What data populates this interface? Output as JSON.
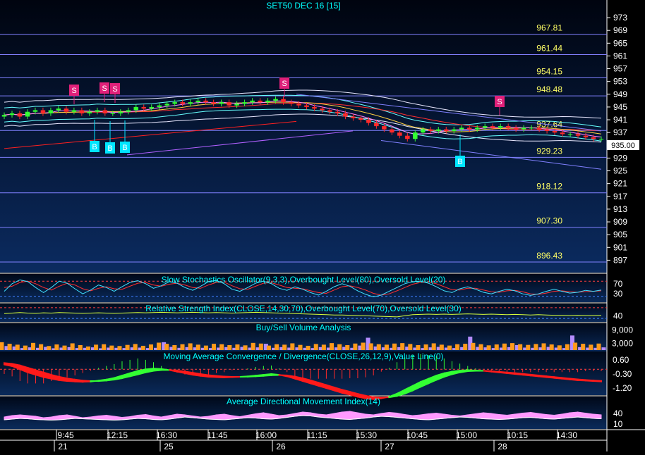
{
  "title": "SET50 DEC 16   [15]",
  "colors": {
    "background_top": "#00061a",
    "background_bottom": "#0a2a5e",
    "fib_line": "#8080ff",
    "fib_label": "#ffff66",
    "axis_text": "#ffffff",
    "last_price_box": "#ffffff",
    "indicator_title": "#00ffff",
    "sell_marker": "#e0207a",
    "buy_marker": "#00e5ff",
    "bar_volume": "#ff9a1a",
    "bar_volume_alt": "#b48cff",
    "macd_fill_neg": "#ff1a1a",
    "macd_fill_pos": "#33ff33",
    "adx_fill": "#ff99ff"
  },
  "chart_data": [
    {
      "type": "line",
      "panel": "price",
      "title": "SET50 DEC 16   [15]",
      "ylim": [
        894,
        975
      ],
      "y_ticks": [
        "973",
        "969",
        "965",
        "961",
        "957",
        "953",
        "949",
        "945",
        "941",
        "937",
        "933",
        "929",
        "925",
        "921",
        "917",
        "913",
        "909",
        "905",
        "901",
        "897"
      ],
      "last_price": "935.00",
      "fib_levels": [
        {
          "label": "967.81",
          "value": 967.81
        },
        {
          "label": "961.44",
          "value": 961.44
        },
        {
          "label": "954.15",
          "value": 954.15
        },
        {
          "label": "948.48",
          "value": 948.48
        },
        {
          "label": "937.64",
          "value": 937.64
        },
        {
          "label": "929.23",
          "value": 929.23
        },
        {
          "label": "918.12",
          "value": 918.12
        },
        {
          "label": "907.30",
          "value": 907.3
        },
        {
          "label": "896.43",
          "value": 896.43
        }
      ],
      "x_time_labels": [
        "9:45",
        "12:15",
        "16:30",
        "11:45",
        "16:00",
        "11:15",
        "15:30",
        "10:45",
        "15:00",
        "10:15",
        "14:30"
      ],
      "x_date_labels": [
        "21",
        "25",
        "26",
        "27",
        "28"
      ],
      "close": [
        942.5,
        943,
        942,
        943.5,
        944,
        943,
        944,
        944.5,
        943.5,
        944,
        943,
        943.5,
        944,
        943,
        943,
        943.5,
        944,
        945,
        944.5,
        945,
        945.5,
        946,
        946.5,
        946,
        946.5,
        947,
        946.5,
        946,
        946.5,
        945.5,
        946,
        946.5,
        947,
        946.5,
        947,
        947.5,
        946.5,
        946,
        945.5,
        945,
        944.5,
        944,
        943.5,
        943,
        942,
        941.5,
        941,
        940,
        939,
        938,
        937,
        936,
        935,
        937,
        938,
        937.5,
        938,
        937.5,
        938,
        938.5,
        938,
        938.5,
        939,
        938.5,
        939,
        938.5,
        938,
        938.5,
        938.5,
        938,
        937.5,
        937,
        936.5,
        936.5,
        936,
        935.5,
        935,
        935
      ]
    },
    {
      "type": "line",
      "panel": "stochastic",
      "title": "Slow Stochastics Oscillator(9,3,3),Overbought Level(80),Oversold Level(20)",
      "y_ticks": [
        "70",
        "30"
      ],
      "ylim": [
        0,
        100
      ],
      "k": [
        40,
        70,
        85,
        78,
        55,
        35,
        55,
        80,
        72,
        50,
        30,
        45,
        65,
        55,
        40,
        58,
        75,
        82,
        70,
        52,
        62,
        78,
        72,
        55,
        44,
        60,
        78,
        83,
        70,
        48,
        40,
        55,
        72,
        80,
        70,
        52,
        44,
        58,
        48,
        35,
        25,
        40,
        58,
        70,
        60,
        42,
        28,
        18,
        25,
        40,
        55,
        70,
        78,
        80,
        72,
        58,
        42,
        35,
        50,
        58,
        48,
        36,
        30,
        40,
        48,
        42,
        30,
        24,
        30,
        40,
        48,
        40,
        33,
        36,
        44,
        40,
        45
      ],
      "d": [
        55,
        60,
        75,
        80,
        70,
        55,
        45,
        60,
        72,
        65,
        50,
        42,
        52,
        58,
        50,
        48,
        60,
        72,
        75,
        65,
        60,
        68,
        72,
        65,
        55,
        52,
        65,
        75,
        76,
        62,
        50,
        48,
        60,
        72,
        74,
        65,
        55,
        52,
        50,
        42,
        35,
        32,
        45,
        58,
        62,
        55,
        45,
        32,
        25,
        30,
        42,
        55,
        68,
        75,
        77,
        70,
        58,
        46,
        45,
        52,
        52,
        45,
        38,
        36,
        42,
        44,
        38,
        30,
        28,
        33,
        40,
        42,
        38,
        36,
        39,
        40,
        42
      ]
    },
    {
      "type": "line",
      "panel": "rsi",
      "title": "Relative Strength Index(CLOSE,14,30,70),Overbought Level(70),Oversold Level(30)",
      "y_ticks": [
        "40"
      ],
      "ylim": [
        20,
        80
      ],
      "values": [
        48,
        50,
        52,
        50,
        49,
        51,
        50,
        52,
        51,
        50,
        49,
        50,
        51,
        50,
        49,
        50,
        51,
        52,
        51,
        52,
        53,
        52,
        51,
        52,
        53,
        52,
        51,
        52,
        51,
        50,
        51,
        52,
        53,
        52,
        51,
        50,
        49,
        48,
        47,
        46,
        45,
        44,
        43,
        43,
        42,
        41,
        40,
        39,
        38,
        37,
        36,
        40,
        44,
        45,
        46,
        45,
        46,
        45,
        46,
        47,
        46,
        45,
        46,
        45,
        44,
        45,
        44,
        43,
        44,
        43,
        42,
        42,
        41,
        42,
        41,
        41,
        42
      ]
    },
    {
      "type": "bar",
      "panel": "volume",
      "title": "Buy/Sell Volume Analysis",
      "y_ticks": [
        "9,000",
        "3,000"
      ],
      "ylim": [
        0,
        11000
      ],
      "buy": [
        3500,
        2800,
        2400,
        2000,
        3200,
        2600,
        1800,
        2500,
        2000,
        3000,
        2200,
        1600,
        2400,
        2600,
        2000,
        1800,
        2300,
        2700,
        1900,
        2500,
        3300,
        2800,
        2200,
        2600,
        3000,
        2400,
        2000,
        2800,
        2600,
        2200,
        2500,
        2100,
        3200,
        2900,
        2000,
        2600,
        2400,
        3000,
        2300,
        1900,
        2700,
        2400,
        3100,
        2600,
        2200,
        2900,
        3300,
        3000,
        2600,
        2400,
        2900,
        3100,
        2700,
        2200,
        2500,
        3000,
        2400,
        2000,
        2600,
        2800,
        3200,
        2600,
        2100,
        2500,
        2900,
        3100,
        2600,
        2300,
        2700,
        3000,
        2500,
        2100,
        2600,
        3300,
        2800,
        2400,
        2900
      ],
      "sell": [
        1800,
        1600,
        900,
        1200,
        1000,
        1400,
        800,
        1100,
        1300,
        900,
        1000,
        1200,
        800,
        1100,
        1000,
        900,
        1200,
        1100,
        900,
        1000,
        3500,
        1400,
        1000,
        1300,
        1200,
        1000,
        900,
        1100,
        1300,
        1000,
        1400,
        1100,
        1200,
        2800,
        1000,
        1300,
        1100,
        1200,
        1000,
        900,
        1300,
        1100,
        1200,
        1400,
        1000,
        2000,
        5500,
        1600,
        1200,
        1000,
        1300,
        1500,
        1100,
        900,
        1200,
        1400,
        1100,
        900,
        1300,
        6000,
        1400,
        1200,
        900,
        1100,
        1300,
        2200,
        1100,
        1000,
        1200,
        1400,
        1100,
        900,
        6500,
        1300,
        1100,
        1000,
        1200
      ]
    },
    {
      "type": "area",
      "panel": "macd",
      "title": "Moving Average Convergence / Divergence(CLOSE,26,12,9),Value Line(0)",
      "y_ticks": [
        "0.60",
        "-0.30",
        "-1.20"
      ],
      "ylim": [
        -1.6,
        1.0
      ],
      "macd": [
        0.3,
        0.2,
        0.0,
        -0.2,
        -0.35,
        -0.5,
        -0.6,
        -0.7,
        -0.75,
        -0.78,
        -0.8,
        -0.78,
        -0.72,
        -0.65,
        -0.55,
        -0.4,
        -0.25,
        -0.1,
        0.0,
        0.05,
        0.02,
        -0.05,
        -0.15,
        -0.25,
        -0.35,
        -0.42,
        -0.48,
        -0.5,
        -0.52,
        -0.5,
        -0.48,
        -0.45,
        -0.4,
        -0.35,
        -0.3,
        -0.35,
        -0.45,
        -0.6,
        -0.75,
        -0.9,
        -1.05,
        -1.2,
        -1.35,
        -1.5,
        -1.62,
        -1.75,
        -1.85,
        -1.9,
        -1.85,
        -1.75,
        -1.55,
        -1.3,
        -1.05,
        -0.8,
        -0.6,
        -0.4,
        -0.25,
        -0.15,
        -0.08,
        -0.05,
        -0.08,
        -0.1,
        -0.15,
        -0.2,
        -0.25,
        -0.3,
        -0.35,
        -0.4,
        -0.45,
        -0.5,
        -0.55,
        -0.6,
        -0.65,
        -0.7,
        -0.72,
        -0.75,
        -0.78
      ],
      "signal": [
        0.4,
        0.35,
        0.25,
        0.1,
        -0.05,
        -0.2,
        -0.35,
        -0.48,
        -0.58,
        -0.65,
        -0.72,
        -0.75,
        -0.75,
        -0.72,
        -0.66,
        -0.57,
        -0.45,
        -0.33,
        -0.2,
        -0.1,
        -0.05,
        -0.05,
        -0.08,
        -0.14,
        -0.22,
        -0.3,
        -0.37,
        -0.42,
        -0.46,
        -0.48,
        -0.48,
        -0.47,
        -0.45,
        -0.42,
        -0.38,
        -0.37,
        -0.39,
        -0.46,
        -0.57,
        -0.7,
        -0.85,
        -1.0,
        -1.15,
        -1.3,
        -1.43,
        -1.56,
        -1.68,
        -1.77,
        -1.8,
        -1.78,
        -1.7,
        -1.55,
        -1.35,
        -1.12,
        -0.9,
        -0.68,
        -0.48,
        -0.32,
        -0.2,
        -0.12,
        -0.1,
        -0.1,
        -0.12,
        -0.16,
        -0.2,
        -0.24,
        -0.29,
        -0.34,
        -0.39,
        -0.44,
        -0.49,
        -0.54,
        -0.59,
        -0.64,
        -0.68,
        -0.71,
        -0.74
      ]
    },
    {
      "type": "area",
      "panel": "adx",
      "title": "Average Directional Movement Index(14)",
      "y_ticks": [
        "40",
        "10"
      ],
      "ylim": [
        0,
        60
      ],
      "adx": [
        22,
        24,
        26,
        25,
        23,
        22,
        21,
        22,
        24,
        26,
        25,
        24,
        23,
        22,
        21,
        22,
        24,
        26,
        25,
        23,
        22,
        24,
        27,
        30,
        28,
        26,
        24,
        23,
        22,
        24,
        26,
        28,
        27,
        25,
        24,
        26,
        29,
        32,
        34,
        33,
        30,
        28,
        26,
        24,
        23,
        25,
        27,
        30,
        32,
        31,
        29,
        27,
        25,
        23,
        22,
        24,
        26,
        28,
        30,
        29,
        27,
        25,
        24,
        23,
        24,
        26,
        28,
        29,
        27,
        25,
        24,
        26,
        28,
        30,
        28,
        26,
        25
      ],
      "di": [
        30,
        34,
        36,
        34,
        32,
        28,
        30,
        34,
        36,
        32,
        28,
        30,
        33,
        35,
        32,
        29,
        31,
        35,
        37,
        33,
        30,
        34,
        38,
        36,
        33,
        30,
        32,
        36,
        38,
        34,
        31,
        35,
        39,
        42,
        38,
        34,
        36,
        40,
        44,
        42,
        38,
        36,
        40,
        44,
        46,
        42,
        38,
        36,
        40,
        43,
        41,
        37,
        34,
        36,
        39,
        41,
        38,
        35,
        33,
        36,
        39,
        42,
        40,
        37,
        35,
        38,
        41,
        43,
        40,
        37,
        35,
        38,
        42,
        44,
        41,
        38,
        36
      ]
    }
  ],
  "signals": [
    {
      "kind": "S",
      "label": "S"
    },
    {
      "kind": "S",
      "label": "S"
    },
    {
      "kind": "S",
      "label": "S"
    },
    {
      "kind": "S",
      "label": "S"
    },
    {
      "kind": "S",
      "label": "S"
    },
    {
      "kind": "B",
      "label": "B"
    },
    {
      "kind": "B",
      "label": "B"
    },
    {
      "kind": "B",
      "label": "B"
    },
    {
      "kind": "B",
      "label": "B"
    }
  ]
}
